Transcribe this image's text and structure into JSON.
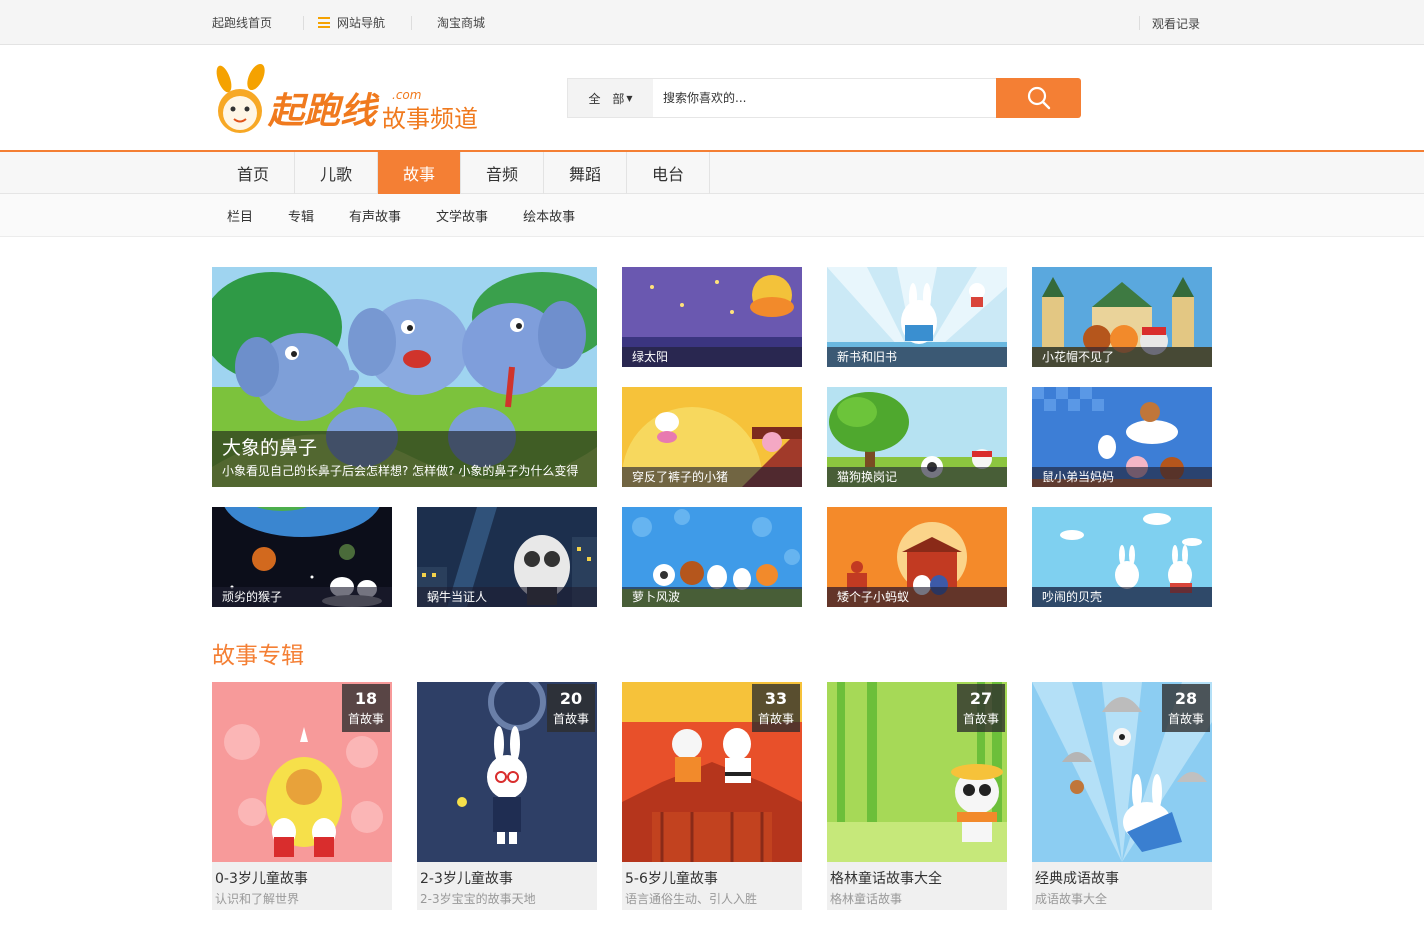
{
  "topbar": {
    "home": "起跑线首页",
    "site_nav": "网站导航",
    "taobao": "淘宝商城",
    "history": "观看记录"
  },
  "logo": {
    "brand": "起跑线",
    "domain": ".com",
    "channel": "故事频道"
  },
  "search": {
    "scope": "全 部",
    "placeholder": "搜索你喜欢的..."
  },
  "nav": {
    "items": [
      "首页",
      "儿歌",
      "故事",
      "音频",
      "舞蹈",
      "电台"
    ],
    "active": "故事"
  },
  "subnav": {
    "items": [
      "栏目",
      "专辑",
      "有声故事",
      "文学故事",
      "绘本故事"
    ]
  },
  "feature": {
    "title": "大象的鼻子",
    "desc": "小象看见自己的长鼻子后会怎样想? 怎样做? 小象的鼻子为什么变得"
  },
  "stories": [
    {
      "title": "绿太阳"
    },
    {
      "title": "新书和旧书"
    },
    {
      "title": "小花帽不见了"
    },
    {
      "title": "穿反了裤子的小猪"
    },
    {
      "title": "猫狗换岗记"
    },
    {
      "title": "鼠小弟当妈妈"
    },
    {
      "title": "顽劣的猴子"
    },
    {
      "title": "蜗牛当证人"
    },
    {
      "title": "萝卜风波"
    },
    {
      "title": "矮个子小蚂蚁"
    },
    {
      "title": "吵闹的贝壳"
    }
  ],
  "albums_section": {
    "title": "故事专辑"
  },
  "albums": [
    {
      "count": "18",
      "unit": "首故事",
      "title": "0-3岁儿童故事",
      "sub": "认识和了解世界"
    },
    {
      "count": "20",
      "unit": "首故事",
      "title": "2-3岁儿童故事",
      "sub": "2-3岁宝宝的故事天地"
    },
    {
      "count": "33",
      "unit": "首故事",
      "title": "5-6岁儿童故事",
      "sub": "语言通俗生动、引人入胜"
    },
    {
      "count": "27",
      "unit": "首故事",
      "title": "格林童话故事大全",
      "sub": "格林童话故事"
    },
    {
      "count": "28",
      "unit": "首故事",
      "title": "经典成语故事",
      "sub": "成语故事大全"
    }
  ]
}
